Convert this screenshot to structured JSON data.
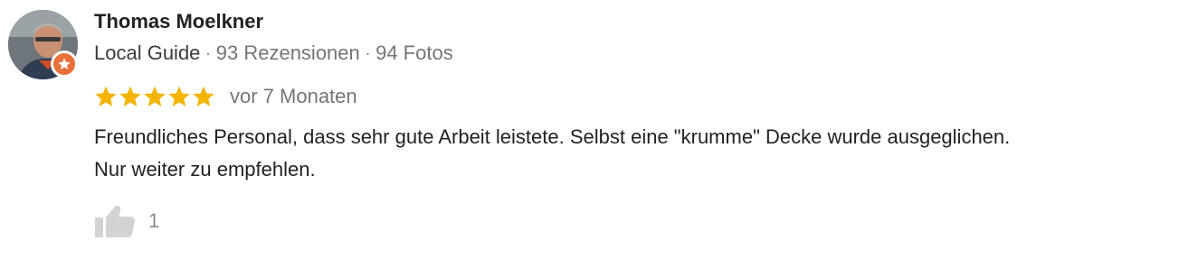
{
  "review": {
    "author": "Thomas Moelkner",
    "guide_label": "Local Guide",
    "reviews_count": "93 Rezensionen",
    "photos_count": "94 Fotos",
    "separator": "·",
    "rating": 5,
    "rating_max": 5,
    "date": "vor 7 Monaten",
    "text_line1": "Freundliches Personal, dass sehr gute Arbeit leistete. Selbst eine \"krumme\" Decke wurde ausgeglichen.",
    "text_line2": "Nur weiter zu empfehlen.",
    "likes": "1"
  },
  "colors": {
    "star": "#f4b400",
    "badge": "#e8703a",
    "name": "#222222",
    "meta": "#757575",
    "like_icon": "#d3d3d3"
  },
  "icons": {
    "avatar": "avatar",
    "badge": "local-guide-badge-icon",
    "star": "star-icon",
    "like": "thumbs-up-icon"
  }
}
